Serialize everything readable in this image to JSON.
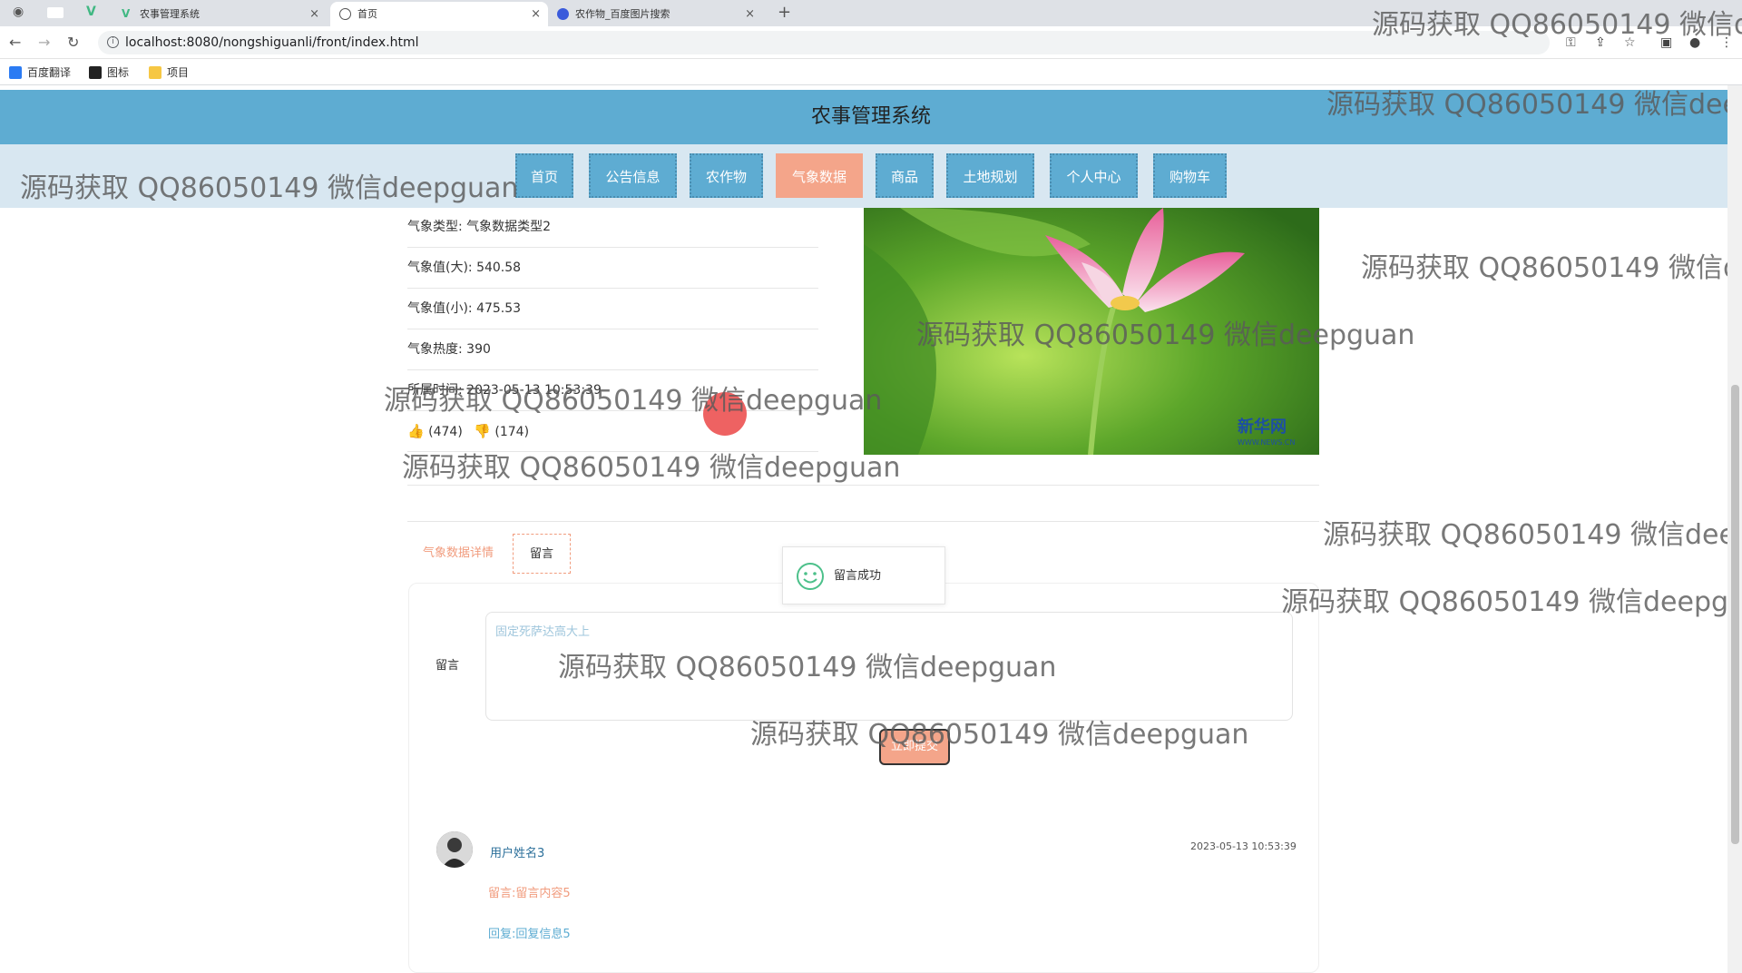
{
  "browser": {
    "tabs": [
      {
        "title": "农事管理系统",
        "close": "×"
      },
      {
        "title": "首页",
        "close": "×"
      },
      {
        "title": "农作物_百度图片搜索",
        "close": "×"
      }
    ],
    "new_tab": "+",
    "url": "localhost:8080/nongshiguanli/front/index.html",
    "bookmarks": [
      "百度翻译",
      "图标",
      "项目"
    ]
  },
  "header": {
    "title": "农事管理系统"
  },
  "nav": {
    "items": [
      "首页",
      "公告信息",
      "农作物",
      "气象数据",
      "商品",
      "土地规划",
      "个人中心",
      "购物车"
    ],
    "active": "气象数据"
  },
  "detail": {
    "rows": [
      "气象类型: 气象数据类型2",
      "气象值(大): 540.58",
      "气象值(小): 475.53",
      "气象热度: 390",
      "所属时间: 2023-05-13 10:53:39"
    ],
    "thumbs_up": "(474)",
    "thumbs_down": "(174)",
    "image_brand": "新华网",
    "image_brand_sub": "WWW.NEWS.CN"
  },
  "subtabs": {
    "detail": "气象数据详情",
    "comment": "留言"
  },
  "toast": {
    "text": "留言成功"
  },
  "form": {
    "label": "留言",
    "textarea_value": "固定死萨达高大上",
    "submit": "立即提交"
  },
  "comments": [
    {
      "user": "用户姓名3",
      "time": "2023-05-13 10:53:39",
      "content": "留言:留言内容5",
      "reply": "回复:回复信息5"
    }
  ],
  "watermark": "源码获取 QQ86050149 微信deepguan",
  "colors": {
    "primary": "#5eacd2",
    "accent": "#f4a58a",
    "navbar_bg": "#d8e7f1"
  }
}
